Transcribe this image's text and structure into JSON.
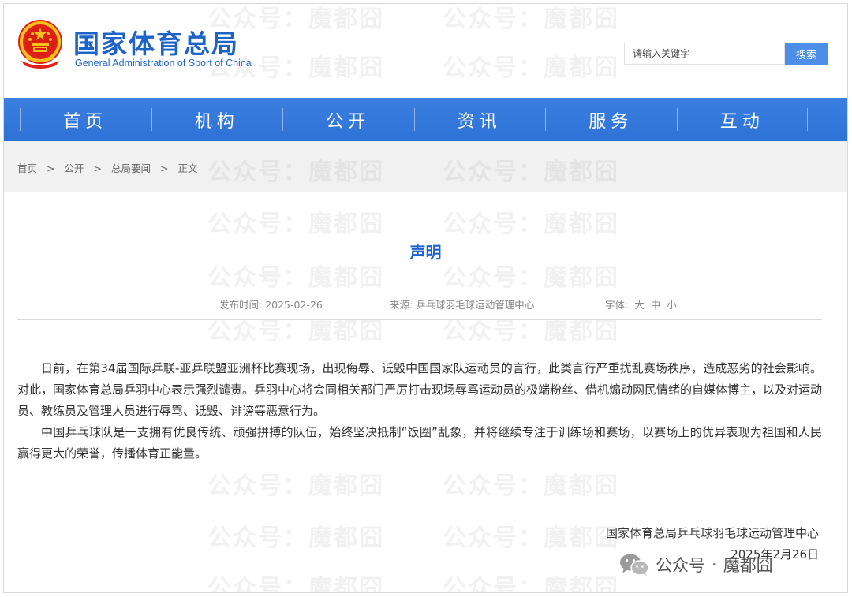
{
  "site": {
    "name_cn": "国家体育总局",
    "name_en": "General Administration of Sport of China"
  },
  "search": {
    "placeholder": "请输入关键字",
    "button": "搜索"
  },
  "nav": [
    "首页",
    "机构",
    "公开",
    "资讯",
    "服务",
    "互动"
  ],
  "breadcrumb": {
    "items": [
      "首页",
      "公开",
      "总局要闻",
      "正文"
    ],
    "separator": ">"
  },
  "article": {
    "title": "声明",
    "meta": {
      "date_label": "发布时间:",
      "date": "2025-02-26",
      "source_label": "来源:",
      "source": "乒乓球羽毛球运动管理中心",
      "font_label": "字体:",
      "font_sizes": [
        "大",
        "中",
        "小"
      ]
    },
    "paragraphs": [
      "日前，在第34届国际乒联-亚乒联盟亚洲杯比赛现场，出现侮辱、诋毁中国国家队运动员的言行，此类言行严重扰乱赛场秩序，造成恶劣的社会影响。对此，国家体育总局乒羽中心表示强烈谴责。乒羽中心将会同相关部门严厉打击现场辱骂运动员的极端粉丝、借机煽动网民情绪的自媒体博主，以及对运动员、教练员及管理人员进行辱骂、诋毁、诽谤等恶意行为。",
      "中国乒乓球队是一支拥有优良传统、顽强拼搏的队伍，始终坚决抵制“饭圈”乱象，并将继续专注于训练场和赛场，以赛场上的优异表现为祖国和人民赢得更大的荣誉，传播体育正能量。"
    ],
    "signature": "国家体育总局乒乓球羽毛球运动管理中心",
    "sign_date": "2025年2月26日"
  },
  "watermark": {
    "text": "公众号：魔都囧",
    "wechat_label": "公众号",
    "wechat_dot": "·",
    "wechat_name": "魔都囧"
  }
}
